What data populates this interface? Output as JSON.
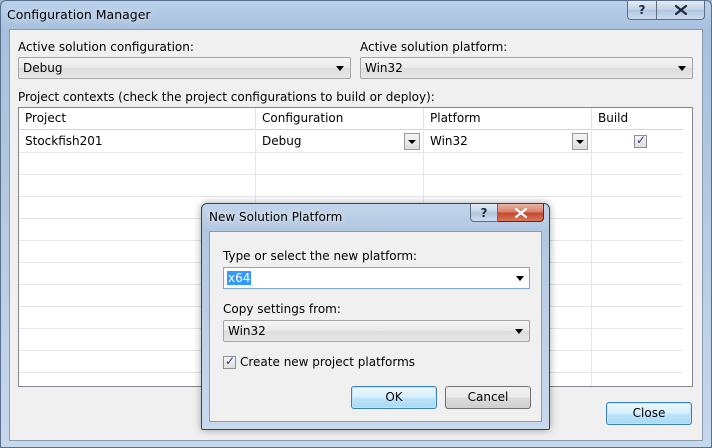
{
  "window": {
    "title": "Configuration Manager",
    "help_glyph": "?",
    "close_glyph": "close-x"
  },
  "solution": {
    "config_label": "Active solution configuration:",
    "config_value": "Debug",
    "platform_label": "Active solution platform:",
    "platform_value": "Win32"
  },
  "contexts": {
    "label": "Project contexts (check the project configurations to build or deploy):",
    "columns": [
      "Project",
      "Configuration",
      "Platform",
      "Build"
    ],
    "rows": [
      {
        "project": "Stockfish201",
        "configuration": "Debug",
        "platform": "Win32",
        "build": true
      }
    ]
  },
  "footer": {
    "close_label": "Close"
  },
  "dialog": {
    "title": "New Solution Platform",
    "new_platform_label": "Type or select the new platform:",
    "new_platform_value": "x64",
    "copy_label": "Copy settings from:",
    "copy_value": "Win32",
    "create_label": "Create new project platforms",
    "create_checked": true,
    "ok_label": "OK",
    "cancel_label": "Cancel"
  }
}
